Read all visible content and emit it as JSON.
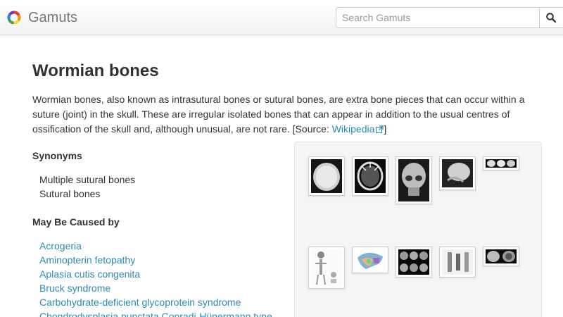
{
  "header": {
    "brand_name": "Gamuts",
    "search_placeholder": "Search Gamuts"
  },
  "article": {
    "title": "Wormian bones",
    "description": "Wormian bones, also known as intrasutural bones or sutural bones, are extra bone pieces that can occur within a suture (joint) in the skull. These are irregular isolated bones that can appear in addition to the usual centres of ossification of the skull and, although unusual, are not rare. [Source: ",
    "source_link": "Wikipedia",
    "source_close": "]"
  },
  "synonyms": {
    "title": "Synonyms",
    "items": [
      "Multiple sutural bones",
      "Sutural bones"
    ]
  },
  "caused_by": {
    "title": "May Be Caused by",
    "items": [
      "Acrogeria",
      "Aminopterin fetopathy",
      "Aplasia cutis congenita",
      "Bruck syndrome",
      "Carbohydrate-deficient glycoprotein syndrome",
      "Chondrodysplasia punctata Conradi-Hünermann type"
    ]
  },
  "colors": {
    "link": "#2a8ab8",
    "text": "#333333",
    "brand_text": "#777777"
  }
}
